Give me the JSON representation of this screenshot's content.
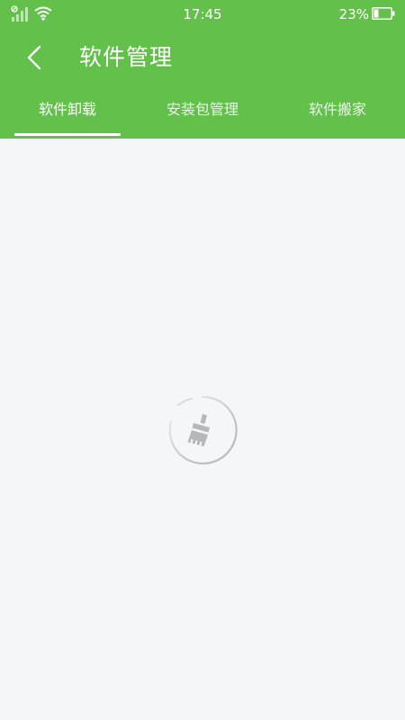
{
  "status_bar": {
    "time": "17:45",
    "battery_percent": "23%",
    "icons": [
      "signal-icon",
      "wifi-icon",
      "battery-icon"
    ]
  },
  "header": {
    "title": "软件管理",
    "back_icon": "chevron-left-icon"
  },
  "tabs": [
    {
      "label": "软件卸载",
      "active": true
    },
    {
      "label": "安装包管理",
      "active": false
    },
    {
      "label": "软件搬家",
      "active": false
    }
  ],
  "main": {
    "loading_icon": "broom-icon"
  },
  "colors": {
    "header_bg": "#62c04b",
    "page_bg": "#f3f7f8",
    "spinner_icon": "#b4b8bb"
  }
}
